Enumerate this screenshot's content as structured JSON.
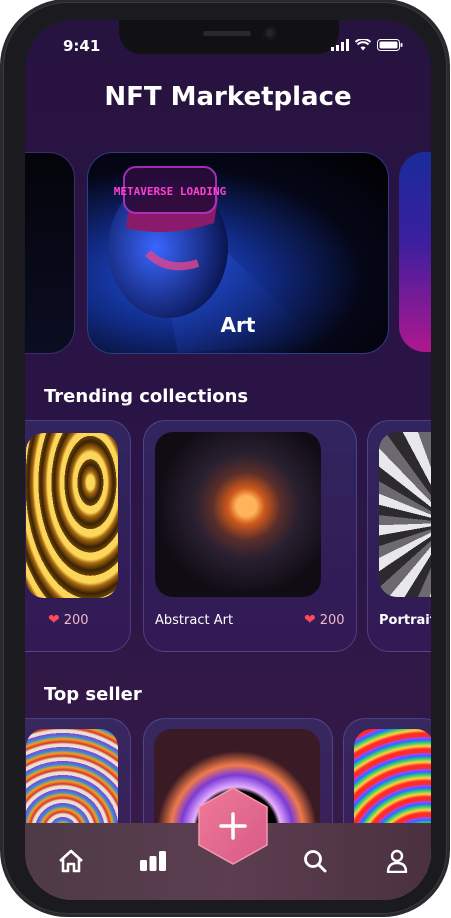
{
  "status_bar": {
    "time": "9:41"
  },
  "page": {
    "title": "NFT Marketplace"
  },
  "hero": {
    "label": "Art",
    "overlay_text": "METAVERSE LOADING"
  },
  "trending": {
    "title": "Trending collections",
    "items": [
      {
        "name": "",
        "likes": "200"
      },
      {
        "name": "Abstract Art",
        "likes": "200"
      },
      {
        "name": "Portrait",
        "likes": ""
      }
    ]
  },
  "top_seller": {
    "title": "Top seller"
  },
  "nav": {
    "items": [
      "home-icon",
      "stats-icon",
      "add-icon",
      "search-icon",
      "profile-icon"
    ]
  },
  "colors": {
    "accent": "#e3607a",
    "heart": "#ff4a5a",
    "background": "#27133f"
  }
}
